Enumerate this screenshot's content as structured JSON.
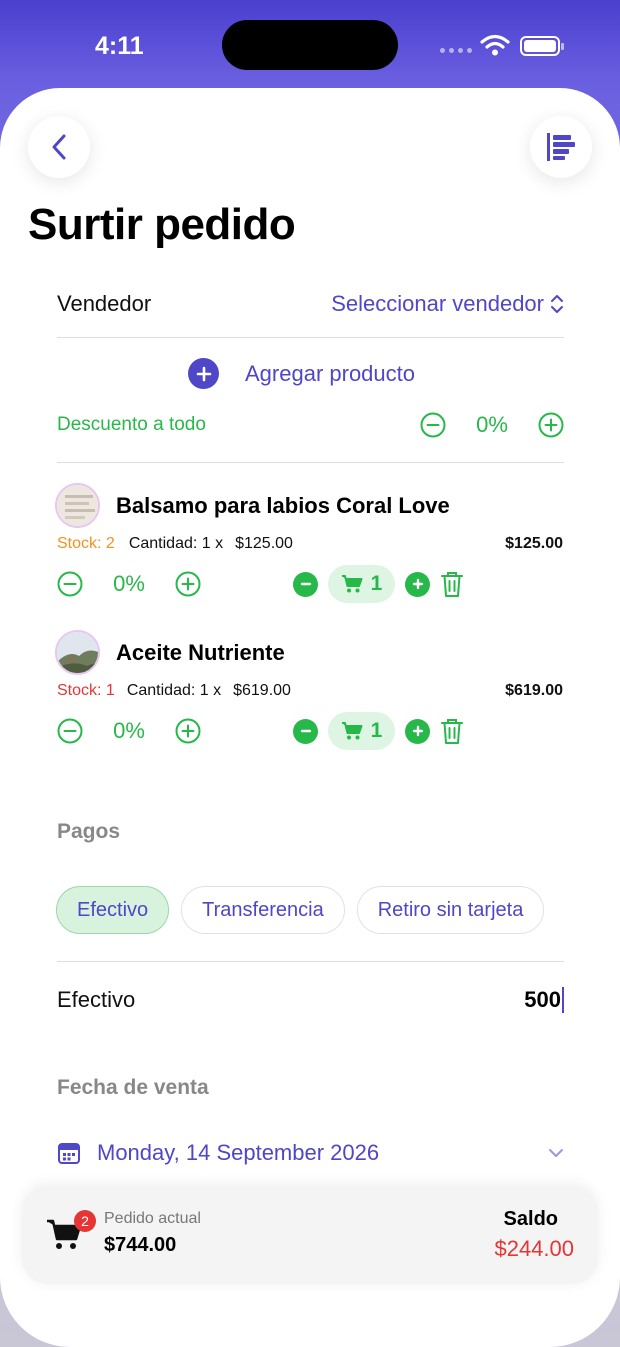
{
  "status_bar": {
    "time": "4:11"
  },
  "header": {
    "title": "Surtir pedido"
  },
  "vendor": {
    "label": "Vendedor",
    "select_label": "Seleccionar vendedor"
  },
  "add_product": {
    "label": "Agregar producto"
  },
  "discount_all": {
    "label": "Descuento a todo",
    "value": "0%"
  },
  "products": [
    {
      "name": "Balsamo para labios Coral Love",
      "stock": "Stock: 2",
      "quantity_text": "Cantidad: 1 x",
      "unit_price": "$125.00",
      "total": "$125.00",
      "discount": "0%",
      "cart_qty": "1"
    },
    {
      "name": "Aceite Nutriente",
      "stock": "Stock: 1",
      "quantity_text": "Cantidad: 1 x",
      "unit_price": "$619.00",
      "total": "$619.00",
      "discount": "0%",
      "cart_qty": "1"
    }
  ],
  "payments": {
    "title": "Pagos",
    "tabs": [
      "Efectivo",
      "Transferencia",
      "Retiro sin tarjeta"
    ],
    "active_tab": "Efectivo",
    "cash_label": "Efectivo",
    "cash_value": "500"
  },
  "sale_date": {
    "title": "Fecha de venta",
    "value": "Monday, 14 September 2026"
  },
  "summary": {
    "cart_count": "2",
    "order_label": "Pedido actual",
    "order_total": "$744.00",
    "balance_label": "Saldo",
    "balance_value": "$244.00"
  },
  "colors": {
    "accent": "#4f46c8",
    "green": "#27b84a",
    "red": "#e53535",
    "orange": "#f0931e"
  }
}
